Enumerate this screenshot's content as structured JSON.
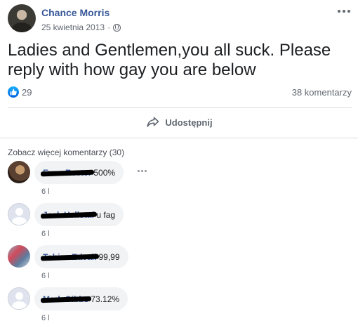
{
  "post": {
    "author": "Chance Morris",
    "date": "25 kwietnia 2013",
    "separator": "·",
    "text": "Ladies and Gentlemen,you all suck. Please reply with how gay you are below",
    "likes": "29",
    "comments_count": "38 komentarzy",
    "share_label": "Udostępnij"
  },
  "comments_section": {
    "view_more": "Zobacz więcej komentarzy (30)",
    "comments": [
      {
        "name": "Evan Reeter",
        "text": "500%",
        "time": "6 l"
      },
      {
        "name": "Jack Hellstaf",
        "text": "u fag",
        "time": "6 l"
      },
      {
        "name": "Tobias Edvall",
        "text": "99,99",
        "time": "6 l"
      },
      {
        "name": "Mark Gibbs",
        "text": "73.12%",
        "time": "6 l"
      }
    ]
  },
  "colors": {
    "link": "#385898",
    "like_blue": "#1877f2",
    "bubble": "#f2f3f5"
  },
  "icons": [
    "globe-icon",
    "more-options-icon",
    "like-icon",
    "share-icon",
    "comment-more-icon"
  ]
}
